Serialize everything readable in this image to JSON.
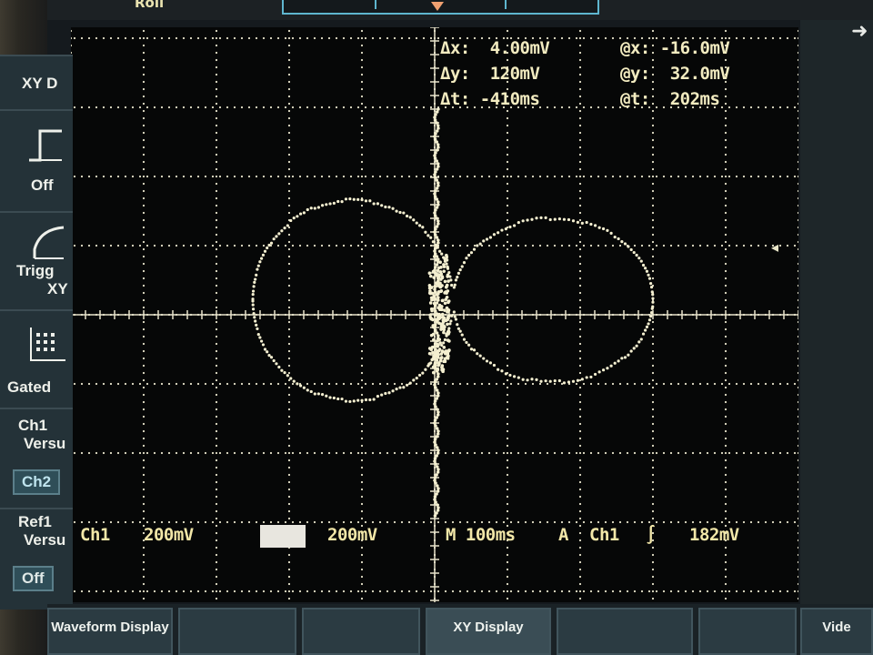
{
  "top": {
    "label": "Roll"
  },
  "readouts": {
    "dx": "Δx:  4.00mV",
    "dy": "Δy:  120mV",
    "dt": "Δt: -410ms",
    "cx": "@x: -16.0mV",
    "cy": "@y:  32.0mV",
    "ct": "@t:  202ms"
  },
  "status": {
    "ch1_label": "Ch1",
    "ch1_scale": "200mV",
    "ch2_scale": "200mV",
    "timebase": "M 100ms",
    "trigger_mode": "A",
    "trigger_source": "Ch1",
    "trigger_slope": "∫",
    "trigger_level": "182mV"
  },
  "side_menu": {
    "title": "XY D",
    "off": "Off",
    "trigger_x": "Trigg",
    "trigger_x2": "XY",
    "gated": "Gated",
    "ch1_versus": "Ch1",
    "ch1_versus2": "Versu",
    "ch2": "Ch2",
    "ref1_versus": "Ref1",
    "ref1_versus2": "Versu",
    "off2": "Off"
  },
  "bottom_menu": [
    {
      "label": "Waveform Display"
    },
    {
      "label": ""
    },
    {
      "label": ""
    },
    {
      "label": "XY Display"
    },
    {
      "label": ""
    },
    {
      "label": ""
    },
    {
      "label": "Vide"
    }
  ],
  "colors": {
    "trace": "#f4efd0",
    "graticule": "#e8e4cc",
    "cursor_readout": "#f2ebc0",
    "ch2_box": "#e8e6df",
    "menu_bg": "#243238"
  }
}
